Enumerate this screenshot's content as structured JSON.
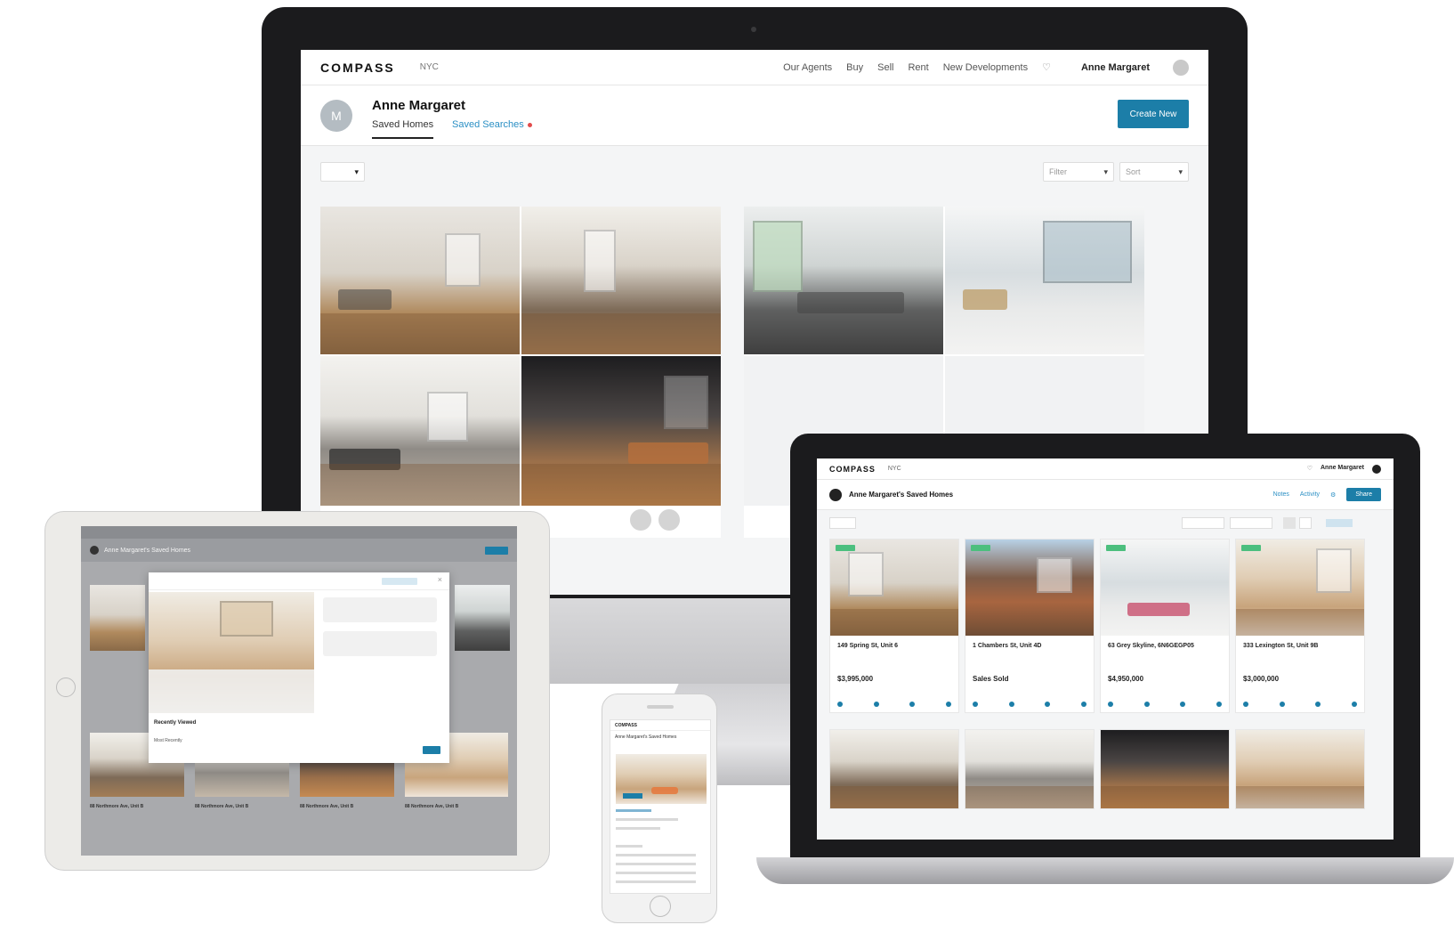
{
  "monitor": {
    "nav": {
      "logo": "COMPASS",
      "city": "NYC",
      "links": [
        "Our Agents",
        "Buy",
        "Sell",
        "Rent",
        "New Developments"
      ],
      "user": "Anne Margaret"
    },
    "profile": {
      "initial": "M",
      "name": "Anne Margaret",
      "tab_saved_homes": "Saved Homes",
      "tab_saved_searches": "Saved Searches",
      "create_button": "Create New"
    },
    "toolbar": {
      "filter_label": "Filter",
      "sort_label": "Sort"
    }
  },
  "laptop": {
    "logo": "COMPASS",
    "city": "NYC",
    "user": "Anne Margaret",
    "header_title": "Anne Margaret's Saved Homes",
    "actions": [
      "Notes",
      "Activity"
    ],
    "share_label": "Share",
    "listings": [
      {
        "address": "149 Spring St, Unit 6",
        "price": "$3,995,000"
      },
      {
        "address": "1 Chambers St, Unit 4D",
        "price": "Sales Sold"
      },
      {
        "address": "63 Grey Skyline, 6N6GEGP05",
        "price": "$4,950,000"
      },
      {
        "address": "333 Lexington St, Unit 9B",
        "price": "$3,000,000"
      }
    ]
  },
  "tablet": {
    "header_title": "Anne Margaret's Saved Homes",
    "modal_caption": "Recently Viewed",
    "modal_sub": "Most Recently",
    "listing_labels": [
      "88 Northmore Ave, Unit B",
      "88 Northmore Ave, Unit B",
      "88 Northmore Ave, Unit B",
      "88 Northmore Ave, Unit B"
    ]
  },
  "phone": {
    "nav_logo": "COMPASS",
    "title": "Anne Margaret's Saved Homes"
  }
}
